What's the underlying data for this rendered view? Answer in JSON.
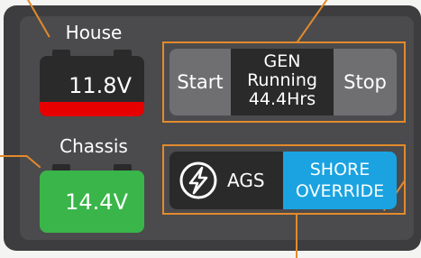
{
  "house": {
    "label": "House",
    "voltage": "11.8V"
  },
  "chassis": {
    "label": "Chassis",
    "voltage": "14.4V"
  },
  "generator": {
    "start_label": "Start",
    "stop_label": "Stop",
    "title": "GEN",
    "status": "Running",
    "hours": "44.4Hrs"
  },
  "ags": {
    "label": "AGS",
    "icon": "lightning-circle-icon"
  },
  "shore_override": {
    "line1": "SHORE",
    "line2": "OVERRIDE"
  },
  "colors": {
    "callout": "#e38a2c",
    "house_level": "#e60000",
    "chassis_body": "#3ab54a",
    "shore_button": "#1aa3e0",
    "button_gray": "#6f6f71",
    "dark_fill": "#2a2a2b"
  }
}
